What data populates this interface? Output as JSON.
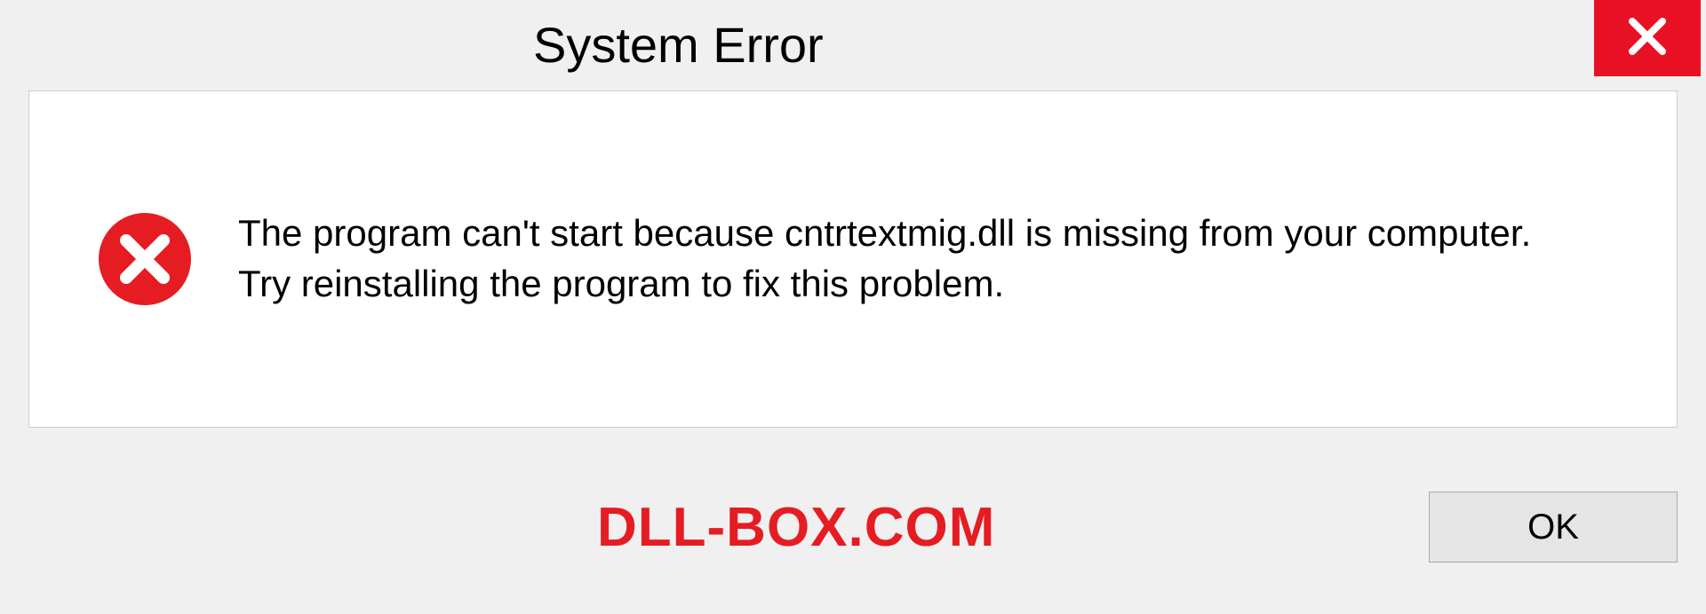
{
  "dialog": {
    "title": "System Error",
    "message": "The program can't start because cntrtextmig.dll is missing from your computer. Try reinstalling the program to fix this problem.",
    "ok_label": "OK"
  },
  "watermark": "DLL-BOX.COM",
  "colors": {
    "close_bg": "#e81123",
    "error_red": "#e61c23"
  }
}
